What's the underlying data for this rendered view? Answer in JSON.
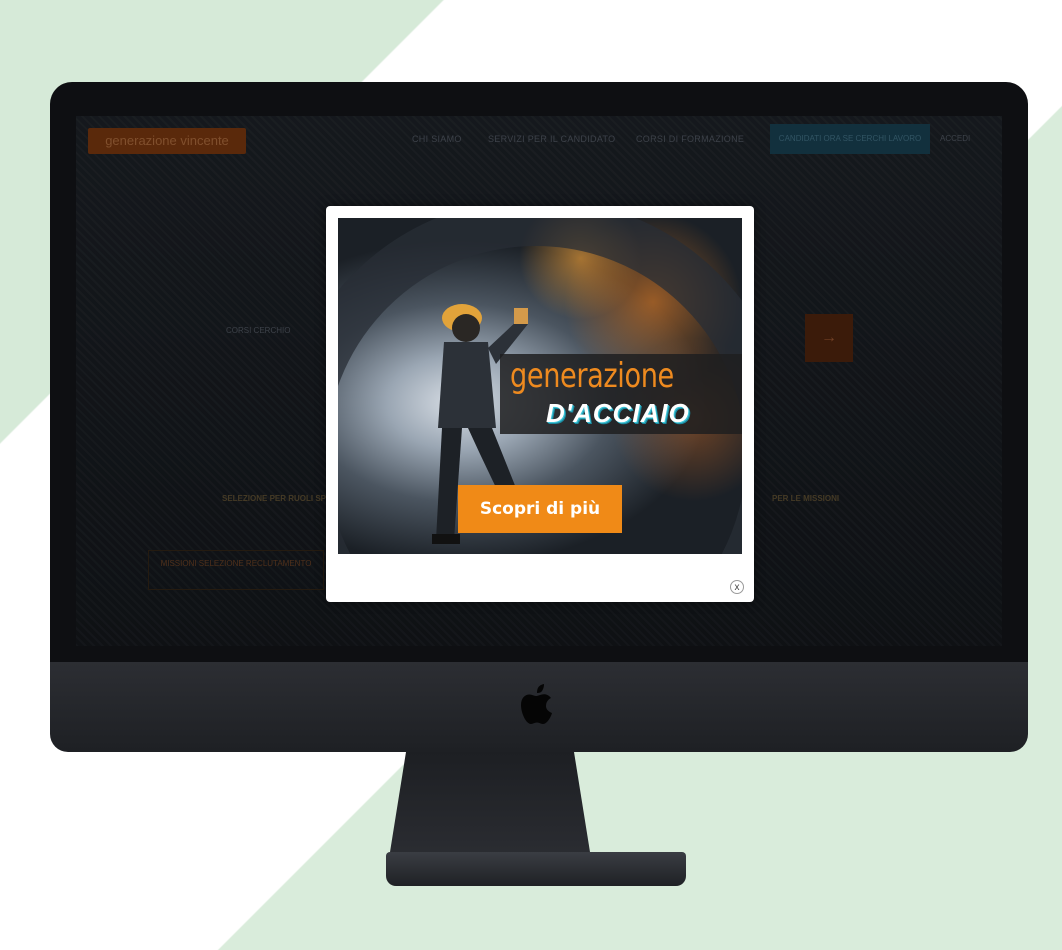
{
  "site": {
    "logo_text": "generazione vincente",
    "nav": [
      "CHI SIAMO",
      "SERVIZI PER IL CANDIDATO",
      "CORSI DI FORMAZIONE"
    ],
    "cta_label": "CANDIDATI ORA SE CERCHI LAVORO",
    "access_label": "ACCEDI",
    "section_label": "CORSI CERCHIO",
    "left_text": "SELEZIONE PER RUOLI SPECIALISTICI",
    "right_text": "PER LE MISSIONI",
    "box_text": "MISSIONI SELEZIONE RECLUTAMENTO",
    "arrow": "→"
  },
  "popup": {
    "title_main": "generazione",
    "title_sub": "D'ACCIAIO",
    "cta_label": "Scopri di più",
    "close_label": "x",
    "accent_color": "#f08a17"
  },
  "icons": {
    "brand_logo": "apple-icon",
    "close": "close-icon"
  }
}
